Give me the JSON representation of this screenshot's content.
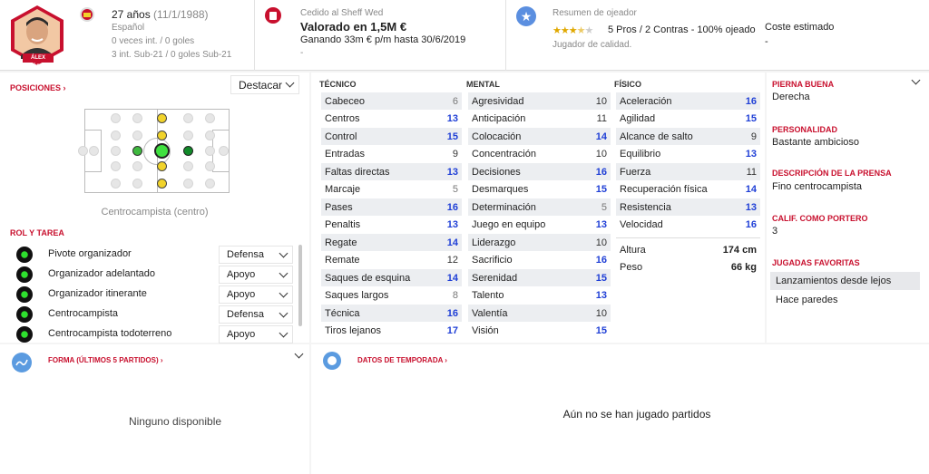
{
  "player": {
    "name_tag": "ÁLEX LÓPEZ",
    "age": "27 años",
    "dob": "(11/1/1988)",
    "nationality": "Español",
    "caps": "0 veces int. / 0 goles",
    "u21": "3 int. Sub-21 / 0 goles Sub-21"
  },
  "contract": {
    "loan": "Cedido al Sheff Wed",
    "value": "Valorado en 1,5M €",
    "wage": "Ganando 33m € p/m hasta 30/6/2019",
    "extra": "-"
  },
  "scout": {
    "title": "Resumen de ojeador",
    "stars": 3.5,
    "summary": "5 Pros / 2 Contras - 100% ojeado",
    "desc": "Jugador de calidad.",
    "cost_label": "Coste estimado",
    "cost_value": "-"
  },
  "positions": {
    "header": "POSICIONES",
    "highlight": "Destacar",
    "label": "Centrocampista (centro)"
  },
  "roles": {
    "header": "ROL Y TAREA",
    "items": [
      {
        "name": "Pivote organizador",
        "duty": "Defensa"
      },
      {
        "name": "Organizador adelantado",
        "duty": "Apoyo"
      },
      {
        "name": "Organizador itinerante",
        "duty": "Apoyo"
      },
      {
        "name": "Centrocampista",
        "duty": "Defensa"
      },
      {
        "name": "Centrocampista todoterreno",
        "duty": "Apoyo"
      }
    ]
  },
  "technical": {
    "header": "TÉCNICO",
    "items": [
      {
        "name": "Cabeceo",
        "value": "6"
      },
      {
        "name": "Centros",
        "value": "13"
      },
      {
        "name": "Control",
        "value": "15"
      },
      {
        "name": "Entradas",
        "value": "9"
      },
      {
        "name": "Faltas directas",
        "value": "13"
      },
      {
        "name": "Marcaje",
        "value": "5"
      },
      {
        "name": "Pases",
        "value": "16"
      },
      {
        "name": "Penaltis",
        "value": "13"
      },
      {
        "name": "Regate",
        "value": "14"
      },
      {
        "name": "Remate",
        "value": "12"
      },
      {
        "name": "Saques de esquina",
        "value": "14"
      },
      {
        "name": "Saques largos",
        "value": "8"
      },
      {
        "name": "Técnica",
        "value": "16"
      },
      {
        "name": "Tiros lejanos",
        "value": "17"
      }
    ]
  },
  "mental": {
    "header": "MENTAL",
    "items": [
      {
        "name": "Agresividad",
        "value": "10"
      },
      {
        "name": "Anticipación",
        "value": "11"
      },
      {
        "name": "Colocación",
        "value": "14"
      },
      {
        "name": "Concentración",
        "value": "10"
      },
      {
        "name": "Decisiones",
        "value": "16"
      },
      {
        "name": "Desmarques",
        "value": "15"
      },
      {
        "name": "Determinación",
        "value": "5"
      },
      {
        "name": "Juego en equipo",
        "value": "13"
      },
      {
        "name": "Liderazgo",
        "value": "10"
      },
      {
        "name": "Sacrificio",
        "value": "16"
      },
      {
        "name": "Serenidad",
        "value": "15"
      },
      {
        "name": "Talento",
        "value": "13"
      },
      {
        "name": "Valentía",
        "value": "10"
      },
      {
        "name": "Visión",
        "value": "15"
      }
    ]
  },
  "physical": {
    "header": "FÍSICO",
    "items": [
      {
        "name": "Aceleración",
        "value": "16"
      },
      {
        "name": "Agilidad",
        "value": "15"
      },
      {
        "name": "Alcance de salto",
        "value": "9"
      },
      {
        "name": "Equilibrio",
        "value": "13"
      },
      {
        "name": "Fuerza",
        "value": "11"
      },
      {
        "name": "Recuperación física",
        "value": "14"
      },
      {
        "name": "Resistencia",
        "value": "13"
      },
      {
        "name": "Velocidad",
        "value": "16"
      }
    ],
    "height_label": "Altura",
    "height": "174 cm",
    "weight_label": "Peso",
    "weight": "66 kg"
  },
  "info": {
    "foot_h": "PIERNA BUENA",
    "foot": "Derecha",
    "pers_h": "PERSONALIDAD",
    "pers": "Bastante ambicioso",
    "press_h": "DESCRIPCIÓN DE LA PRENSA",
    "press": "Fino centrocampista",
    "gk_h": "CALIF. COMO PORTERO",
    "gk": "3",
    "moves_h": "JUGADAS FAVORITAS",
    "moves": [
      "Lanzamientos desde lejos",
      "Hace paredes"
    ]
  },
  "form": {
    "header": "FORMA (ÚLTIMOS 5 PARTIDOS)",
    "empty": "Ninguno disponible"
  },
  "season": {
    "header": "DATOS DE TEMPORADA",
    "empty": "Aún no se han jugado partidos"
  },
  "colors": {
    "accent": "#c8102e",
    "high": "#1f3fd6"
  }
}
